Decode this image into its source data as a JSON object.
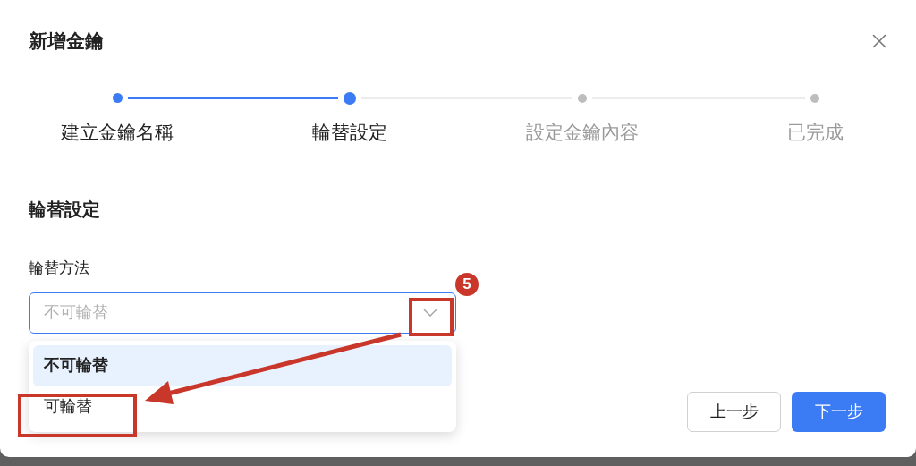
{
  "dialog": {
    "title": "新增金鑰"
  },
  "steps": [
    {
      "label": "建立金鑰名稱",
      "completed": true,
      "selected": false
    },
    {
      "label": "輪替設定",
      "completed": false,
      "selected": true
    },
    {
      "label": "設定金鑰內容",
      "completed": false,
      "selected": false
    },
    {
      "label": "已完成",
      "completed": false,
      "selected": false
    }
  ],
  "section": {
    "heading": "輪替設定",
    "field_label": "輪替方法",
    "select": {
      "placeholder": "不可輪替",
      "expanded": true
    },
    "options": [
      {
        "label": "不可輪替",
        "selected": true
      },
      {
        "label": "可輪替",
        "selected": false
      }
    ]
  },
  "buttons": [
    {
      "label": "上一步",
      "kind": "secondary"
    },
    {
      "label": "下一步",
      "kind": "primary"
    }
  ],
  "annotation": {
    "badge": "5"
  }
}
